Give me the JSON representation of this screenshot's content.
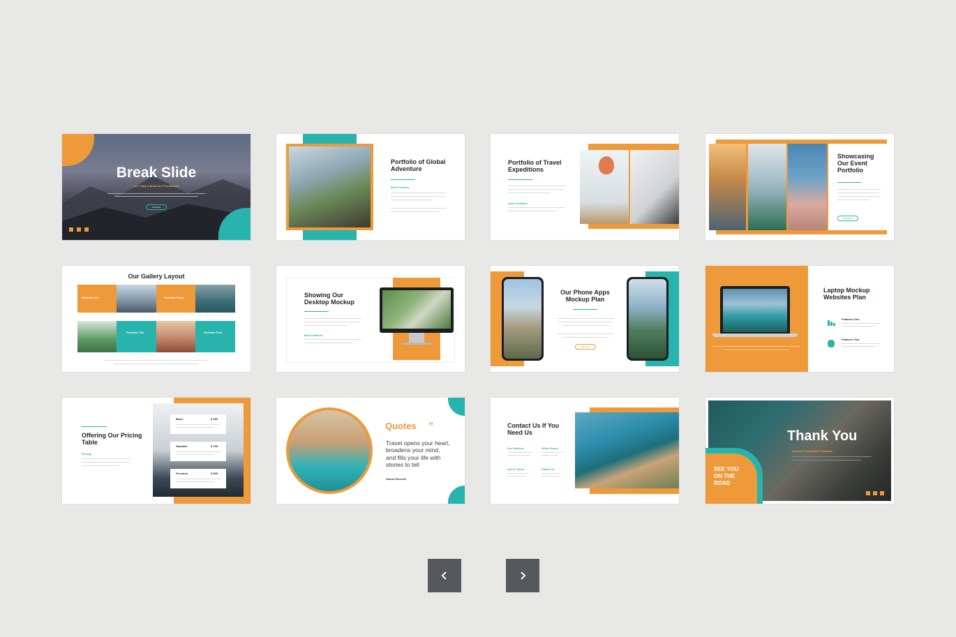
{
  "slides": {
    "break": {
      "title": "Break Slide",
      "subtitle": "Let's Take a Break for Five Minutes",
      "button": "Continue"
    },
    "global": {
      "title": "Portfolio of Global Adventure",
      "label": "Best Portfolio"
    },
    "travel": {
      "title": "Portfolio of Travel Expeditions",
      "label": "Open Portfolio"
    },
    "event": {
      "title": "Showcasing Our Event Portfolio",
      "button": "Read More"
    },
    "gallery": {
      "title": "Our Gallery Layout",
      "items": [
        "Portfolio One",
        "Portfolio Three",
        "Portfolio Two",
        "Portfolio Four"
      ]
    },
    "desktop": {
      "title": "Showing Our Desktop Mockup",
      "label": "Best Features"
    },
    "phone": {
      "title": "Our Phone Apps Mockup Plan",
      "button": "Download"
    },
    "laptop": {
      "title": "Laptop Mockup Websites Plan",
      "features": [
        "Features One",
        "Features Two"
      ]
    },
    "pricing": {
      "title": "Offering Our Pricing Table",
      "label": "Pricing",
      "plans": [
        {
          "name": "Basic",
          "price": "$ 499"
        },
        {
          "name": "Standart",
          "price": "$ 799"
        },
        {
          "name": "Premium",
          "price": "$ 999"
        }
      ]
    },
    "quotes": {
      "title": "Quotes",
      "mark": "”",
      "text": "Travel opens your heart, broadens your mind, and fills your life with stories to tell",
      "author": "Simon Emerick"
    },
    "contact": {
      "title": "Contact Us If You Need Us",
      "labels": [
        "Our Address",
        "Office Hours",
        "Get in Touch",
        "Follow Us"
      ]
    },
    "thanks": {
      "title": "Thank You",
      "subtitle": "Tourism Presentation Template",
      "badge": "SEE YOU ON THE ROAD"
    }
  },
  "nav": {
    "prev": "previous",
    "next": "next"
  }
}
